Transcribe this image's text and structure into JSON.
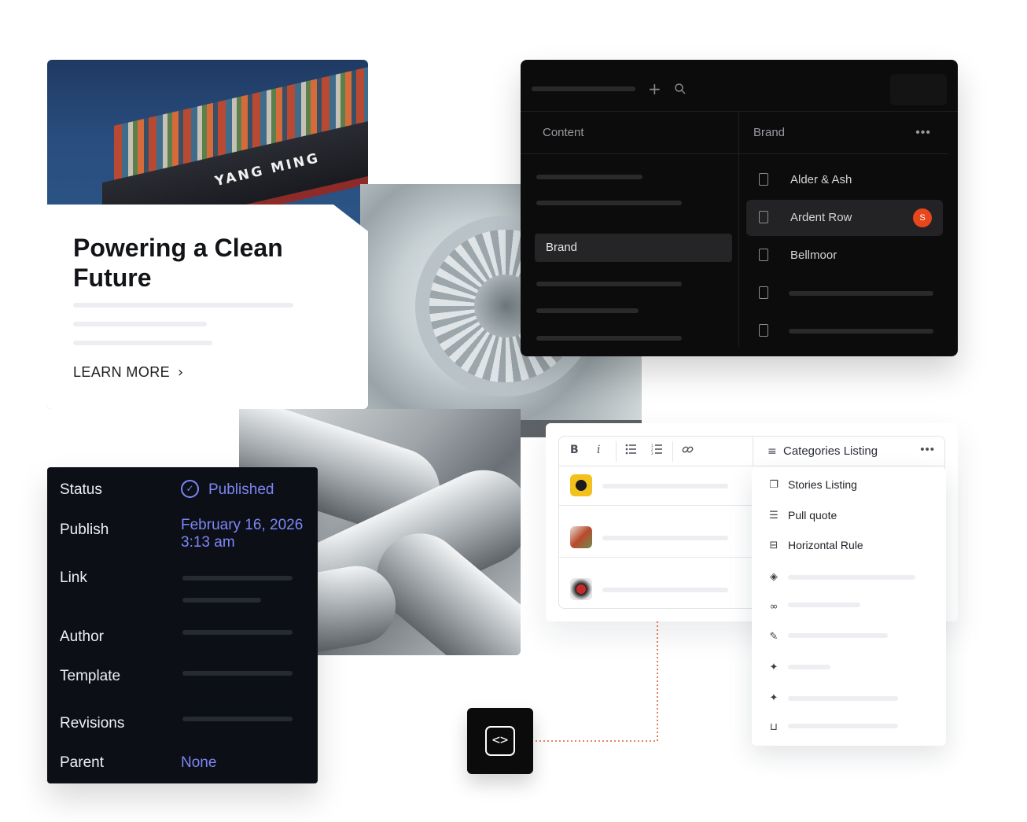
{
  "article": {
    "ship_name": "YANG MING",
    "title": "Powering a Clean Future",
    "cta": "LEARN MORE"
  },
  "cms": {
    "columns": {
      "content": "Content",
      "brand": "Brand"
    },
    "selected_content": "Brand",
    "brands": [
      {
        "label": "Alder & Ash"
      },
      {
        "label": "Ardent Row",
        "avatar": "S"
      },
      {
        "label": "Bellmoor"
      }
    ],
    "accent": "#e8461c"
  },
  "settings": {
    "status_label": "Status",
    "status_value": "Published",
    "publish_label": "Publish",
    "publish_date": "February 16, 2026",
    "publish_time": "3:13 am",
    "link_label": "Link",
    "author_label": "Author",
    "template_label": "Template",
    "revisions_label": "Revisions",
    "parent_label": "Parent",
    "parent_value": "None",
    "accent": "#7c86f5"
  },
  "editor": {
    "toolbar": {
      "bold": "B",
      "italic": "i"
    },
    "category_title": "Categories Listing"
  },
  "dropdown": {
    "items": [
      {
        "label": "Stories Listing"
      },
      {
        "label": "Pull quote"
      },
      {
        "label": "Horizontal Rule"
      }
    ]
  }
}
